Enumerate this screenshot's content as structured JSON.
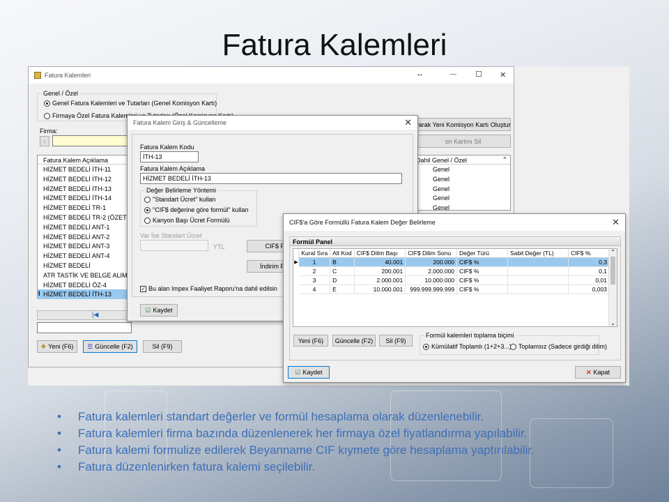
{
  "slide": {
    "title": "Fatura Kalemleri",
    "bullets": [
      "Fatura kalemleri standart değerler ve formül hesaplama olarak düzenlenebilir.",
      "Fatura kalemleri firma bazında düzenlenerek her firmaya özel fiyatlandırma yapılabilir.",
      "Fatura kalemi formulize edilerek Beyanname CIF kıymete göre hesaplama yaptırılabilir.",
      "Fatura düzenlenirken fatura kalemi seçilebilir."
    ]
  },
  "main": {
    "title": "Fatura Kalemleri",
    "arrow": "↔",
    "min": "—",
    "max": "☐",
    "close": "✕",
    "group_label": "Genel / Özel",
    "radio_genel": "Genel Fatura Kalemleri ve Tutarları (Genel Komisyon Kartı)",
    "radio_ozel": "Firmaya Özel Fatura Kalemleri ve Tutarları (Özel Komisyon Kartı)",
    "firma_label": "Firma:",
    "btn_olustur": "yarak Yeni Komisyon Kartı Oluştur",
    "btn_sil_kart": "on Kartını Sil",
    "list_header": "Fatura Kalem Açıklama",
    "list_items": [
      "HİZMET BEDELİ İTH-11",
      "HİZMET BEDELİ İTH-12",
      "HİZMET BEDELİ İTH-13",
      "HİZMET BEDELİ İTH-14",
      "HİZMET BEDELİ TR-1",
      "HİZMET BEDELİ TR-2 (ÖZET BE",
      "HİZMET BEDELİ ANT-1",
      "HİZMET BEDELİ ANT-2",
      "HİZMET BEDELİ ANT-3",
      "HİZMET BEDELİ ANT-4",
      "HİZMET BEDELİ",
      "ATR TASTİK VE BELGE ALIM  B",
      "HİZMET BEDELİ ÖZ-4",
      "HİZMET BEDELİ İTH-13"
    ],
    "right_header_a": "Dahil",
    "right_header_b": "Genel / Özel",
    "right_values": [
      "Genel",
      "Genel",
      "Genel",
      "Genel",
      "Genel"
    ],
    "nav_first": "|◀",
    "btn_yeni": "Yeni (F6)",
    "btn_guncelle": "Güncelle (F2)",
    "btn_sil": "Sil (F9)"
  },
  "giris": {
    "title": "Fatura Kalem Giriş & Güncelleme",
    "close": "✕",
    "kod_label": "Fatura Kalem Kodu",
    "kod_value": "İTH-13",
    "aciklama_label": "Fatura Kalem Açıklama",
    "aciklama_value": "HİZMET BEDELİ İTH-13",
    "yontem_label": "Değer Belirleme Yöntemi",
    "opt1": "\"Standart Ücret\" kullan",
    "opt2": "\"CIF$ değerine göre formül\" kullan",
    "opt3": "Kanyon Başı Ücret Formülü",
    "var_label": "Var İse Standart Ücret",
    "ytl": "YTL",
    "cif_btn": "CIF$ F",
    "indirim_btn": "İndirim F",
    "rapor_chk": "Bu alan Impex Faaliyet Raporu'na dahil edilsin",
    "kaydet": "Kaydet"
  },
  "formul": {
    "title": "CIF$'a Göre Formüllü Fatura Kalem Değer Belirleme",
    "close": "✕",
    "panel_label": "Formül Panel",
    "columns": [
      "Kural Sıra",
      "Alt Kod",
      "CIF$ Dilim Başı",
      "CIF$ Dilim Sonu",
      "Değer Türü",
      "Sabit Değer (TL)",
      "CIF$ %"
    ],
    "rows": [
      [
        "1",
        "B",
        "40.001",
        "200.000",
        "CIF$ %",
        "",
        "0,3"
      ],
      [
        "2",
        "C",
        "200.001",
        "2.000.000",
        "CIF$ %",
        "",
        "0,1"
      ],
      [
        "3",
        "D",
        "2.000.001",
        "10.000.000",
        "CIF$ %",
        "",
        "0,01"
      ],
      [
        "4",
        "E",
        "10.000.001",
        "999.999.999.999",
        "CIF$ %",
        "",
        "0,003"
      ]
    ],
    "btn_yeni": "Yeni (F6)",
    "btn_guncelle": "Güncelle (F2)",
    "btn_sil": "Sil (F9)",
    "toplama_label": "Formül kalemleri toplama biçimi",
    "opt_kumulatif": "Kümülatif Toplamlı (1+2+3...)",
    "opt_toplamsiz": "Toplamsız (Sadece girdiği dilim)",
    "kaydet": "Kaydet",
    "kapat": "Kapat"
  },
  "colors": {
    "bullet": "#3c6fb6",
    "selection": "#99c9ef",
    "accent_border": "#0078d7"
  }
}
